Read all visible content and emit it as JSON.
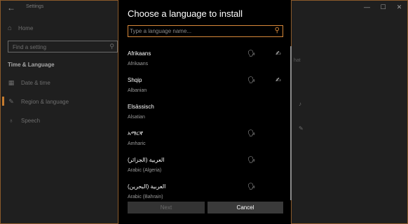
{
  "settings": {
    "title": "Settings",
    "window_controls": [
      "—",
      "☐",
      "✕"
    ],
    "nav_home": "Home",
    "find_placeholder": "Find a setting",
    "section": "Time & Language",
    "nav_items": [
      {
        "label": "Date & time",
        "icon": "calendar-icon"
      },
      {
        "label": "Region & language",
        "icon": "region-icon"
      },
      {
        "label": "Speech",
        "icon": "microphone-icon"
      }
    ],
    "right_text": "hat"
  },
  "dialog": {
    "title": "Choose a language to install",
    "search_placeholder": "Type a language name...",
    "languages": [
      {
        "native": "Afrikaans",
        "english": "Afrikaans",
        "features": [
          "text-to-speech-icon",
          "handwriting-icon"
        ]
      },
      {
        "native": "Shqip",
        "english": "Albanian",
        "features": [
          "text-to-speech-icon",
          "handwriting-icon"
        ]
      },
      {
        "native": "Elsässisch",
        "english": "Alsatian",
        "features": []
      },
      {
        "native": "አማርኛ",
        "english": "Amharic",
        "features": [
          "text-to-speech-icon"
        ]
      },
      {
        "native": "العربية (الجزائر)",
        "english": "Arabic (Algeria)",
        "features": [
          "text-to-speech-icon"
        ]
      },
      {
        "native": "العربية (البحرين)",
        "english": "Arabic (Bahrain)",
        "features": [
          "text-to-speech-icon"
        ]
      }
    ],
    "next_label": "Next",
    "cancel_label": "Cancel"
  }
}
